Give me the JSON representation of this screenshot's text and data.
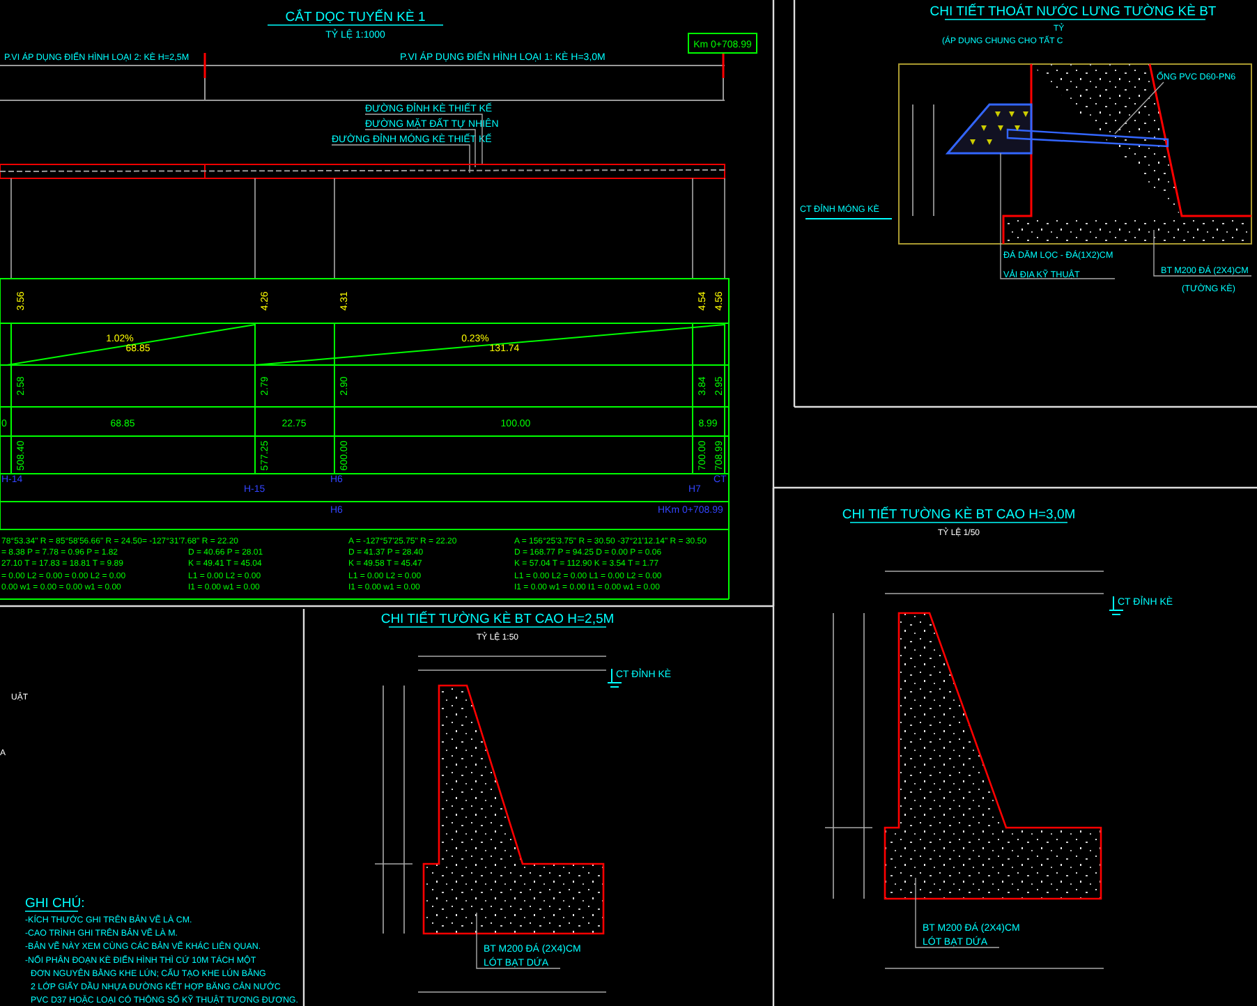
{
  "profile": {
    "title": "CẮT DỌC TUYẾN KÈ 1",
    "scale": "TỶ LỆ 1:1000",
    "range_labels": [
      "P.VI ÁP DỤNG ĐIỂN HÌNH LOẠI 2: KÈ H=2,5M",
      "P.VI ÁP DỤNG ĐIỂN HÌNH LOẠI 1: KÈ H=3,0M"
    ],
    "end_station": "Km 0+708.99",
    "legend": [
      "ĐƯỜNG ĐỈNH KÈ THIẾT KẾ",
      "ĐƯỜNG MẶT ĐẤT TỰ NHIÊN",
      "ĐƯỜNG ĐỈNH MÓNG KÈ THIẾT KẾ"
    ],
    "design_elevations": [
      "3.56",
      "4.26",
      "4.31",
      "4.54",
      "4.56"
    ],
    "grades": [
      {
        "percent": "1.02%",
        "length": "68.85"
      },
      {
        "percent": "0.23%",
        "length": "131.74"
      }
    ],
    "ground_elevations": [
      "2.58",
      "2.79",
      "2.90",
      "3.84",
      "2.95"
    ],
    "distances": [
      "0",
      "68.85",
      "22.75",
      "100.00",
      "8.99"
    ],
    "stations": [
      "508.40",
      "577.25",
      "600.00",
      "700.00",
      "708.99"
    ],
    "points_upper": [
      "H-14",
      "H-15",
      "H6",
      "H7",
      "CT"
    ],
    "points_lower": [
      "H6",
      "HKm 0+708.99"
    ],
    "curve_elements": [
      {
        "lines": [
          "78°53.34\" R = 85°58'56.66\" R = 24.50= -127°31'7.68\" R = 22.20",
          "= 8.38 P = 7.78 = 0.96 P = 1.82",
          "27.10 T = 17.83 = 18.81 T = 9.89",
          "= 0.00 L2 = 0.00 = 0.00 L2 = 0.00",
          "0.00 w1 = 0.00 = 0.00 w1 = 0.00"
        ]
      },
      {
        "lines": [
          "D = 40.66 P = 28.01",
          "K = 49.41 T = 45.04",
          "L1 = 0.00 L2 = 0.00",
          "I1 = 0.00 w1 = 0.00"
        ]
      },
      {
        "lines": [
          "A = -127°57'25.75\" R = 22.20",
          "D = 41.37 P = 28.40",
          "K = 49.58 T = 45.47",
          "L1 = 0.00 L2 = 0.00",
          "I1 = 0.00 w1 = 0.00"
        ]
      },
      {
        "lines": [
          "A = 156°25'3.75\" R = 30.50 -37°21'12.14\" R = 30.50",
          "D = 168.77 P = 94.25 D = 0.00 P = 0.06",
          "K = 57.04 T = 112.90 K = 3.54 T = 1.77",
          "L1 = 0.00 L2 = 0.00 L1 = 0.00 L2 = 0.00",
          "I1 = 0.00 w1 = 0.00 I1 = 0.00 w1 = 0.00"
        ]
      }
    ]
  },
  "drainage_detail": {
    "title": "CHI TIẾT THOÁT NƯỚC LƯNG TƯỜNG KÈ BT",
    "scale": "TỶ",
    "note": "(ÁP DỤNG CHUNG CHO TẤT C",
    "labels": [
      "ỐNG PVC D60-PN6",
      "CT ĐỈNH MÓNG KÈ",
      "ĐÁ DĂM LỌC - ĐÁ(1X2)CM",
      "VẢI ĐỊA KỸ THUẬT",
      "BT M200 ĐÁ (2X4)CM",
      "(TƯỜNG KÈ)"
    ]
  },
  "partial_texts": [
    "UẬT",
    "A"
  ],
  "wall_details": [
    {
      "title": "CHI TIẾT TƯỜNG KÈ BT CAO H=2,5M",
      "scale": "TỶ LỆ 1:50",
      "crest_label": "CT ĐỈNH KÈ",
      "material": "BT M200 ĐÁ (2X4)CM",
      "bedding": "LÓT BẠT DỨA"
    },
    {
      "title": "CHI TIẾT TƯỜNG KÈ BT CAO H=3,0M",
      "scale": "TỶ LỆ 1/50",
      "crest_label": "CT ĐỈNH KÈ",
      "material": "BT M200 ĐÁ (2X4)CM",
      "bedding": "LÓT BẠT DỨA"
    }
  ],
  "notes": {
    "title": "GHI CHÚ:",
    "lines": [
      "-KÍCH THƯỚC GHI TRÊN BẢN VẼ LÀ CM.",
      "-CAO TRÌNH GHI TRÊN BẢN VẼ LÀ M.",
      "-BẢN VẼ NÀY XEM CÙNG CÁC BẢN VẼ KHÁC LIÊN QUAN.",
      "-NỐI PHÂN ĐOẠN KÈ ĐIỂN HÌNH THÌ CỨ 10M TÁCH MỘT",
      "ĐƠN NGUYÊN BẰNG KHE LÚN; CẤU TẠO KHE LÚN BẰNG",
      "2 LỚP GIẤY DẦU NHỰA ĐƯỜNG KẾT HỢP BĂNG CẢN NƯỚC",
      "PVC D37 HOẶC LOẠI CÓ THÔNG SỐ KỸ THUẬT TƯƠNG ĐƯƠNG."
    ]
  }
}
